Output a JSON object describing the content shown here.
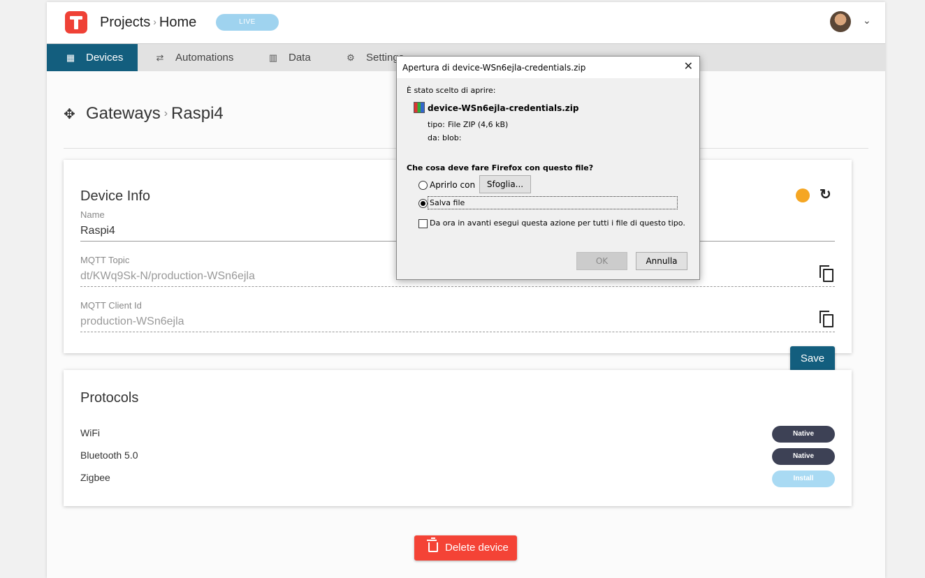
{
  "header": {
    "breadcrumb": [
      "Projects",
      "Home"
    ],
    "status_badge": "LIVE",
    "colors": {
      "accent": "#135e7e",
      "logo": "#ef4136",
      "live": "#9fd3ef"
    }
  },
  "nav": {
    "items": [
      {
        "label": "Devices",
        "icon": "grid-icon",
        "active": true
      },
      {
        "label": "Automations",
        "icon": "automation-icon",
        "active": false
      },
      {
        "label": "Data",
        "icon": "chart-icon",
        "active": false
      },
      {
        "label": "Settings",
        "icon": "gear-icon",
        "active": false
      }
    ]
  },
  "page": {
    "breadcrumb": [
      "Gateways",
      "Raspi4"
    ]
  },
  "device_info": {
    "title": "Device Info",
    "status_color": "#f5a623",
    "fields": [
      {
        "label": "Name",
        "value": "Raspi4"
      },
      {
        "label": "MQTT Topic",
        "value": "dt/KWq9Sk-N/production-WSn6ejla"
      },
      {
        "label": "MQTT Client Id",
        "value": "production-WSn6ejla"
      }
    ],
    "save_label": "Save"
  },
  "protocols": {
    "title": "Protocols",
    "items": [
      {
        "name": "WiFi",
        "action": "Native"
      },
      {
        "name": "Bluetooth 5.0",
        "action": "Native"
      },
      {
        "name": "Zigbee",
        "action": "Install"
      }
    ]
  },
  "delete_label": "Delete device",
  "dialog": {
    "title": "Apertura di device-WSn6ejla-credentials.zip",
    "chosen_text": "È stato scelto di aprire:",
    "filename": "device-WSn6ejla-credentials.zip",
    "type_label": "tipo:",
    "type_value": "File ZIP (4,6 kB)",
    "from_label": "da:",
    "from_value": "blob:",
    "question": "Che cosa deve fare Firefox con questo file?",
    "open_with_label": "Aprirlo con",
    "browse_label": "Sfoglia...",
    "save_file_label": "Salva file",
    "remember_label": "Da ora in avanti esegui questa azione per tutti i file di questo tipo.",
    "ok_label": "OK",
    "cancel_label": "Annulla"
  }
}
